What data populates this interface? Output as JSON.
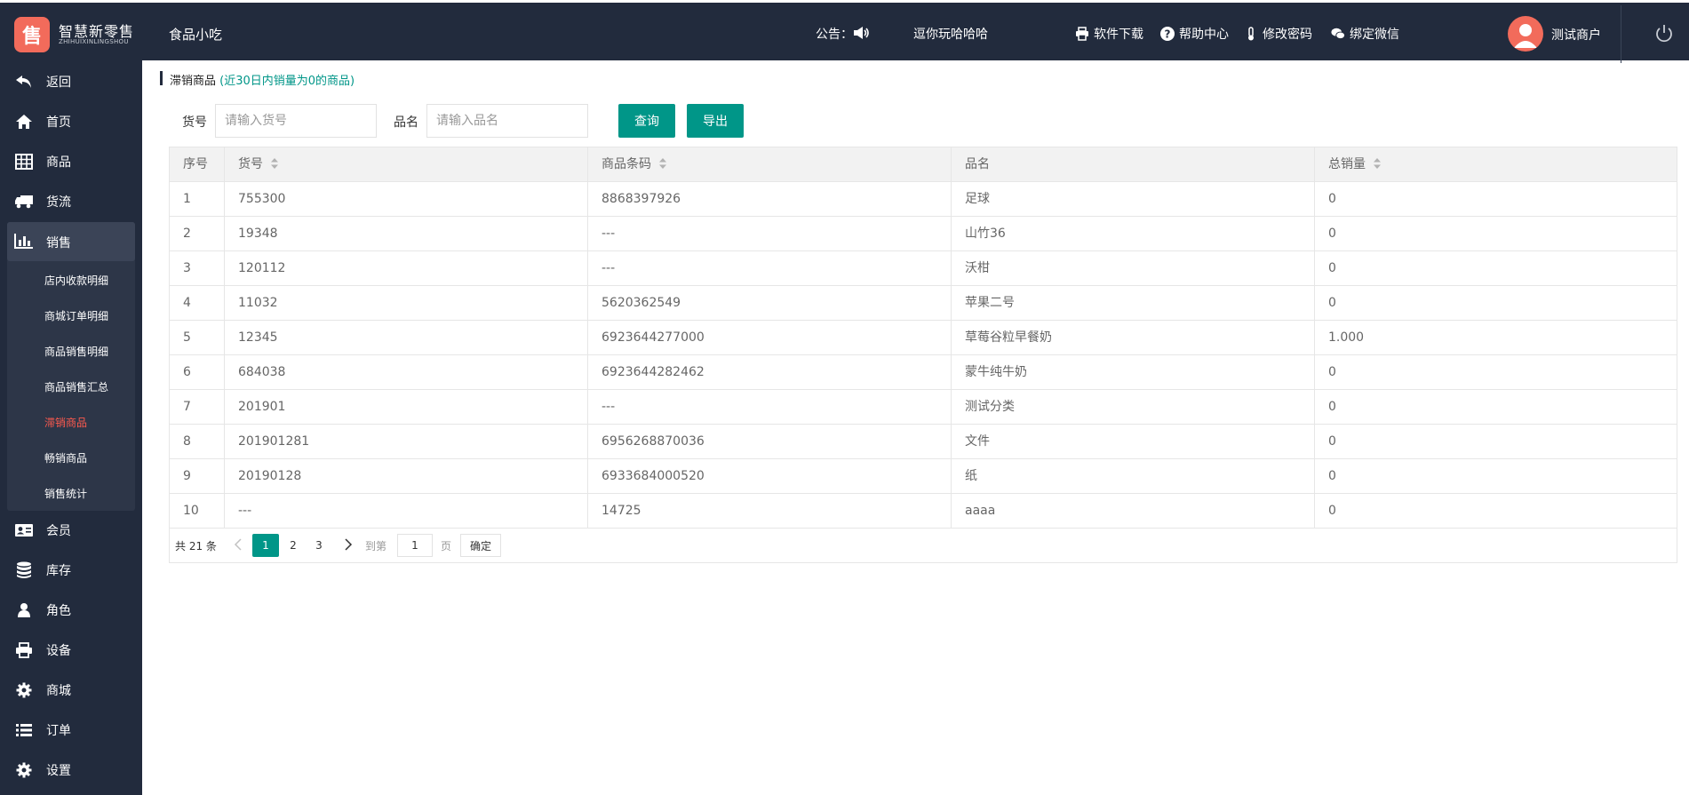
{
  "brand": {
    "logo_glyph": "售",
    "name": "智慧新零售",
    "subtitle": "ZHIHUIXINLINGSHOU"
  },
  "header": {
    "store_name": "食品小吃",
    "notice_label": "公告：",
    "notice_text": "逗你玩哈哈哈",
    "links": [
      {
        "label": "软件下载",
        "icon": "printer-icon"
      },
      {
        "label": "帮助中心",
        "icon": "question-icon"
      },
      {
        "label": "修改密码",
        "icon": "thermometer-icon"
      },
      {
        "label": "绑定微信",
        "icon": "wechat-icon"
      }
    ],
    "user_name": "测试商户"
  },
  "sidebar": {
    "items": [
      {
        "label": "返回",
        "icon": "back-arrow-icon"
      },
      {
        "label": "首页",
        "icon": "home-icon"
      },
      {
        "label": "商品",
        "icon": "table-icon"
      },
      {
        "label": "货流",
        "icon": "truck-icon"
      },
      {
        "label": "销售",
        "icon": "bar-chart-icon"
      },
      {
        "label": "会员",
        "icon": "id-card-icon"
      },
      {
        "label": "库存",
        "icon": "database-icon"
      },
      {
        "label": "角色",
        "icon": "user-icon"
      },
      {
        "label": "设备",
        "icon": "printer-icon"
      },
      {
        "label": "商城",
        "icon": "gear-icon"
      },
      {
        "label": "订单",
        "icon": "list-icon"
      },
      {
        "label": "设置",
        "icon": "gear-icon"
      }
    ],
    "sales_sub": [
      {
        "label": "店内收款明细"
      },
      {
        "label": "商城订单明细"
      },
      {
        "label": "商品销售明细"
      },
      {
        "label": "商品销售汇总"
      },
      {
        "label": "滞销商品",
        "active": true
      },
      {
        "label": "畅销商品"
      },
      {
        "label": "销售统计"
      }
    ]
  },
  "page": {
    "title": "滞销商品",
    "note": "(近30日内销量为0的商品)"
  },
  "filters": {
    "code_label": "货号",
    "code_placeholder": "请输入货号",
    "name_label": "品名",
    "name_placeholder": "请输入品名",
    "query_label": "查询",
    "export_label": "导出"
  },
  "table": {
    "headers": [
      "序号",
      "货号",
      "商品条码",
      "品名",
      "总销量"
    ],
    "rows": [
      [
        "1",
        "755300",
        "8868397926",
        "足球",
        "0"
      ],
      [
        "2",
        "19348",
        "---",
        "山竹36",
        "0"
      ],
      [
        "3",
        "120112",
        "---",
        "沃柑",
        "0"
      ],
      [
        "4",
        "11032",
        "5620362549",
        "苹果二号",
        "0"
      ],
      [
        "5",
        "12345",
        "6923644277000",
        "草莓谷粒早餐奶",
        "1.000"
      ],
      [
        "6",
        "684038",
        "6923644282462",
        "蒙牛纯牛奶",
        "0"
      ],
      [
        "7",
        "201901",
        "---",
        "测试分类",
        "0"
      ],
      [
        "8",
        "201901281",
        "6956268870036",
        "文件",
        "0"
      ],
      [
        "9",
        "20190128",
        "6933684000520",
        "纸",
        "0"
      ],
      [
        "10",
        "---",
        "14725",
        "aaaa",
        "0"
      ]
    ]
  },
  "pager": {
    "total": "共 21 条",
    "pages": [
      "1",
      "2",
      "3"
    ],
    "current": "1",
    "goto_label": "到第",
    "goto_value": "1",
    "page_label": "页",
    "ok_label": "确定"
  },
  "colors": {
    "accent": "#009688",
    "sidebar": "#222b3d",
    "active_sub": "#ff5a4e",
    "brand": "#f26b5b"
  }
}
